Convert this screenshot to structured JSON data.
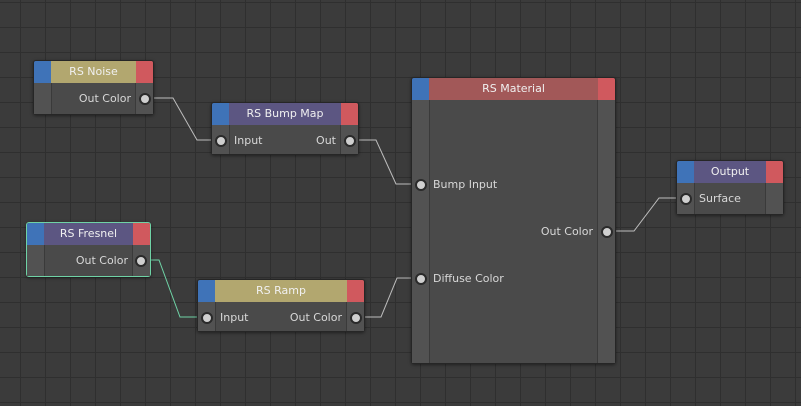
{
  "colors": {
    "canvas": "#3b3b3b",
    "grid": "#2f2f2f",
    "node_body": "#4a4a4a",
    "input_cap": "#3f73b8",
    "output_cap": "#d0595e",
    "header_texture": "#b2a76f",
    "header_shader": "#5c5682",
    "header_material": "#a25858",
    "selection": "#6fd3a6",
    "wire": "#bdbdbd"
  },
  "nodes": {
    "noise": {
      "title": "RS Noise",
      "out": "Out Color"
    },
    "bump": {
      "title": "RS Bump Map",
      "in": "Input",
      "out": "Out"
    },
    "fresnel": {
      "title": "RS Fresnel",
      "out": "Out Color"
    },
    "ramp": {
      "title": "RS Ramp",
      "in": "Input",
      "out": "Out Color"
    },
    "material": {
      "title": "RS Material",
      "in_bump": "Bump Input",
      "in_diffuse": "Diffuse Color",
      "out": "Out Color"
    },
    "output": {
      "title": "Output",
      "in": "Surface"
    }
  }
}
